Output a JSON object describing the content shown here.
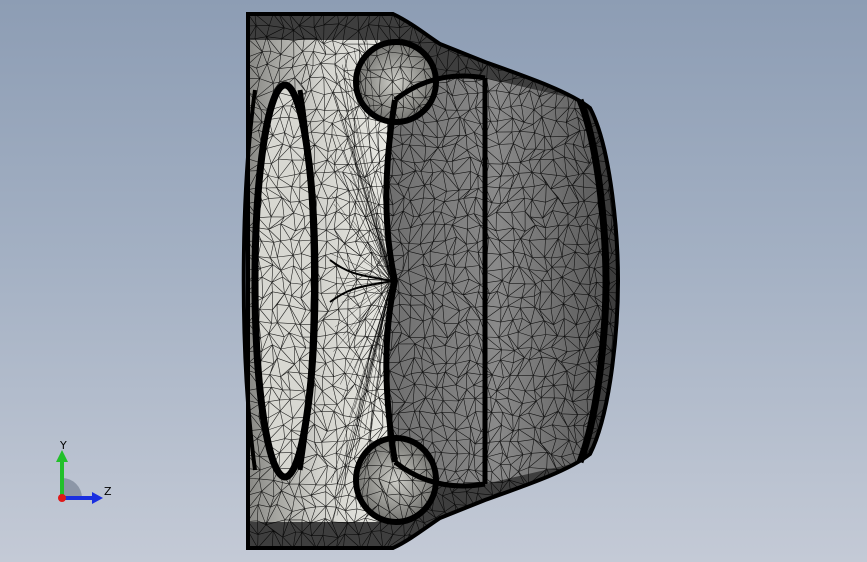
{
  "viewport": {
    "background_top": "#8d9db4",
    "background_bottom": "#c4cad6"
  },
  "model": {
    "display_mode": "mesh-wireframe-shaded",
    "edge_color": "#000000"
  },
  "triad": {
    "y_label": "Y",
    "z_label": "Z",
    "y_color": "#22c02a",
    "z_color": "#1a2fe0",
    "x_color": "#e01818"
  }
}
